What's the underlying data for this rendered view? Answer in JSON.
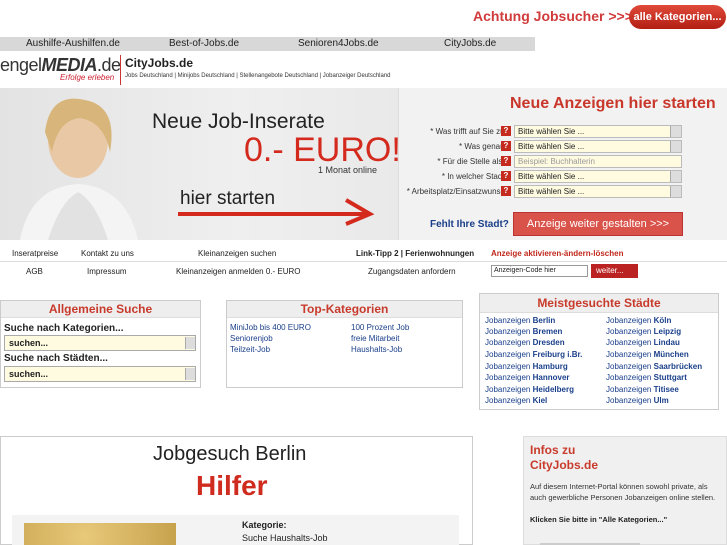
{
  "top": {
    "achtung": "Achtung Jobsucher >>>",
    "alle_kategorien": "alle Kategorien..."
  },
  "sites": [
    "Aushilfe-Aushilfen.de",
    "Best-of-Jobs.de",
    "Senioren4Jobs.de",
    "CityJobs.de"
  ],
  "logo": {
    "brand_light": "engel",
    "brand_bold": "MEDIA",
    "brand_tld": ".de",
    "tagline": "Erfolge erleben"
  },
  "header": {
    "title": "CityJobs.de",
    "links": "Jobs Deutschland | Minijobs Deutschland | Stellenangebote Deutschland | Jobanzeiger Deutschland"
  },
  "banner": {
    "headline": "Neue Job-Inserate",
    "price": "0.- EURO!",
    "duration": "1 Monat online",
    "cta": "hier starten"
  },
  "form": {
    "title": "Neue Anzeigen hier starten",
    "rows": [
      {
        "label": "Was trifft auf Sie zu?",
        "value": "Bitte wählen Sie ..."
      },
      {
        "label": "Was genau?",
        "value": "Bitte wählen Sie ..."
      },
      {
        "label": "Für die Stelle als...",
        "value": "Beispiel: Buchhalterin"
      },
      {
        "label": "In welcher Stadt?",
        "value": "Bitte wählen Sie ..."
      },
      {
        "label": "Arbeitsplatz/Einsatzwunsch",
        "value": "Bitte wählen Sie ..."
      }
    ],
    "help_glyph": "?",
    "fehlt": "Fehlt Ihre Stadt?",
    "submit": "Anzeige weiter gestalten >>>"
  },
  "nav": {
    "row1": [
      "Inseratpreise",
      "Kontakt zu uns",
      "Kleinanzeigen suchen",
      "Link-Tipp 2 | Ferienwohnungen",
      "Anzeige aktivieren-ändern-löschen"
    ],
    "row2": [
      "AGB",
      "Impressum",
      "Kleinanzeigen anmelden 0.- EURO",
      "Zugangsdaten anfordern"
    ],
    "code_placeholder": "Anzeigen-Code hier",
    "code_button": "weiter..."
  },
  "allgemeine_suche": {
    "title": "Allgemeine Suche",
    "kategorien_label": "Suche nach Kategorien...",
    "kategorien_value": "suchen...",
    "staedte_label": "Suche nach Städten...",
    "staedte_value": "suchen..."
  },
  "top_kategorien": {
    "title": "Top-Kategorien",
    "col1": [
      "MiniJob bis 400 EURO",
      "Seniorenjob",
      "Teilzeit-Job"
    ],
    "col2": [
      "100 Prozent Job",
      "freie Mitarbeit",
      "Haushalts-Job"
    ]
  },
  "staedte": {
    "title": "Meistgesuchte Städte",
    "prefix": "Jobanzeigen",
    "col1": [
      "Berlin",
      "Bremen",
      "Dresden",
      "Freiburg i.Br.",
      "Hamburg",
      "Hannover",
      "Heidelberg",
      "Kiel"
    ],
    "col2": [
      "Köln",
      "Leipzig",
      "Lindau",
      "München",
      "Saarbrücken",
      "Stuttgart",
      "Titisee",
      "Ulm"
    ]
  },
  "jobgesuch": {
    "title": "Jobgesuch Berlin",
    "subtitle": "Hilfer",
    "kategorie_label": "Kategorie:",
    "kategorie_value": "Suche Haushalts-Job"
  },
  "infos": {
    "title": "Infos zu CityJobs.de",
    "text": "Auf diesem Internet-Portal können sowohl private, als auch gewerbliche Personen Jobanzeigen online stellen.",
    "cta": "Klicken Sie bitte in \"Alle Kategorien...\""
  },
  "colors": {
    "accent_red": "#c83b2c",
    "link_blue": "#1a3f8a",
    "button_red": "#d9534a"
  }
}
